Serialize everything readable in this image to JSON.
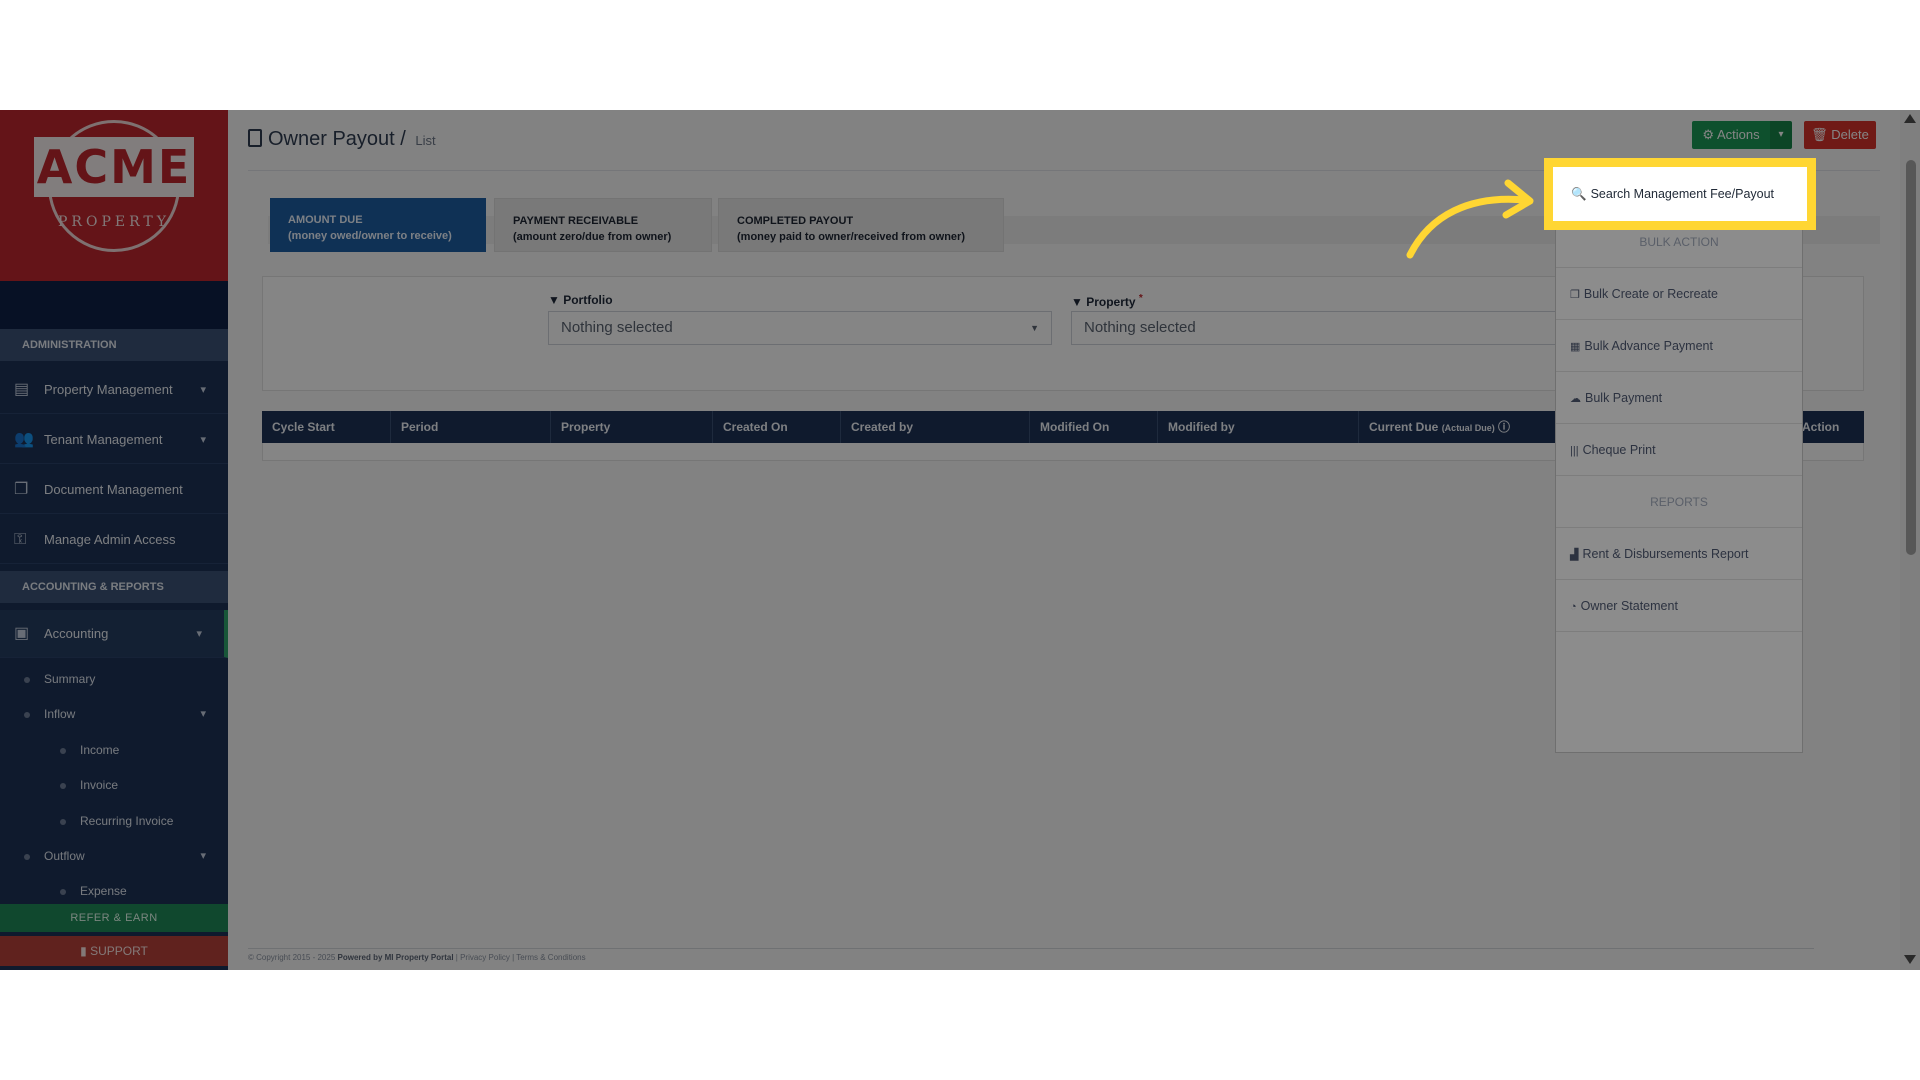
{
  "logo": {
    "text": "ACME",
    "sub": "PROPERTY"
  },
  "sidebar": {
    "section_admin": "ADMINISTRATION",
    "items": [
      {
        "label": "Property Management",
        "icon": "building-icon"
      },
      {
        "label": "Tenant Management",
        "icon": "users-icon"
      },
      {
        "label": "Document Management",
        "icon": "documents-icon"
      },
      {
        "label": "Manage Admin Access",
        "icon": "key-icon"
      }
    ],
    "section_accounting": "ACCOUNTING & REPORTS",
    "accounting": {
      "label": "Accounting",
      "icon": "money-icon"
    },
    "subitems": {
      "summary": "Summary",
      "inflow": "Inflow",
      "income": "Income",
      "invoice": "Invoice",
      "recurring_invoice": "Recurring Invoice",
      "outflow": "Outflow",
      "expense": "Expense"
    },
    "refer": "REFER & EARN",
    "support": "SUPPORT"
  },
  "header": {
    "title": "Owner Payout",
    "separator": "/",
    "crumb": "List",
    "actions_label": "Actions",
    "delete_label": "Delete"
  },
  "tabs": [
    {
      "line1": "AMOUNT DUE",
      "line2": "(money owed/owner to receive)",
      "active": true
    },
    {
      "line1": "PAYMENT RECEIVABLE",
      "line2": "(amount zero/due from owner)",
      "active": false
    },
    {
      "line1": "COMPLETED PAYOUT",
      "line2": "(money paid to owner/received from owner)",
      "active": false
    }
  ],
  "filters": {
    "portfolio_label": "Portfolio",
    "portfolio_value": "Nothing selected",
    "property_label": "Property",
    "property_required": "*",
    "property_value": "Nothing selected"
  },
  "table": {
    "columns": [
      "Cycle Start",
      "Period",
      "Property",
      "Created On",
      "Created by",
      "Modified On",
      "Modified by",
      "Current Due",
      "Action"
    ],
    "current_due_note": "(Actual Due)"
  },
  "dropdown": {
    "search": "Search Management Fee/Payout",
    "bulk_action_head": "BULK ACTION",
    "bulk_create": "Bulk Create or Recreate",
    "bulk_advance": "Bulk Advance Payment",
    "bulk_payment": "Bulk Payment",
    "cheque_print": "Cheque Print",
    "reports_head": "REPORTS",
    "rent_report": "Rent & Disbursements Report",
    "owner_statement": "Owner Statement"
  },
  "footer": {
    "copyright": "© Copyright 2015 - 2025",
    "powered": "Powered by MI Property Portal",
    "privacy": "| Privacy Policy | Terms & Conditions"
  },
  "colors": {
    "sidebar_bg": "#1e3356",
    "logo_red": "#c0282e",
    "actions_green": "#1c9a57",
    "delete_red": "#d7322b",
    "highlight_yellow": "#ffd633",
    "tab_active_blue": "#1d5ea4"
  }
}
